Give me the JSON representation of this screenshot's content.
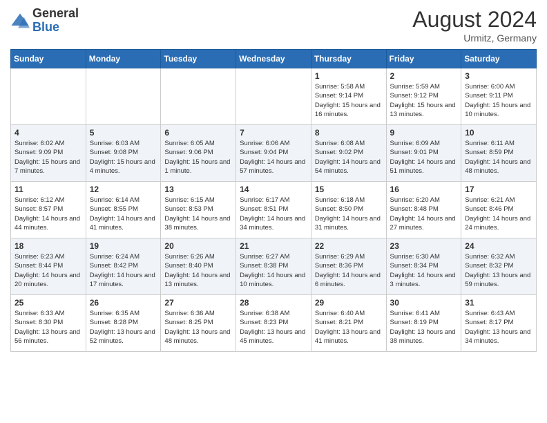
{
  "logo": {
    "general": "General",
    "blue": "Blue"
  },
  "title": "August 2024",
  "location": "Urmitz, Germany",
  "days_of_week": [
    "Sunday",
    "Monday",
    "Tuesday",
    "Wednesday",
    "Thursday",
    "Friday",
    "Saturday"
  ],
  "weeks": [
    [
      {
        "num": "",
        "sunrise": "",
        "sunset": "",
        "daylight": ""
      },
      {
        "num": "",
        "sunrise": "",
        "sunset": "",
        "daylight": ""
      },
      {
        "num": "",
        "sunrise": "",
        "sunset": "",
        "daylight": ""
      },
      {
        "num": "",
        "sunrise": "",
        "sunset": "",
        "daylight": ""
      },
      {
        "num": "1",
        "sunrise": "Sunrise: 5:58 AM",
        "sunset": "Sunset: 9:14 PM",
        "daylight": "Daylight: 15 hours and 16 minutes."
      },
      {
        "num": "2",
        "sunrise": "Sunrise: 5:59 AM",
        "sunset": "Sunset: 9:12 PM",
        "daylight": "Daylight: 15 hours and 13 minutes."
      },
      {
        "num": "3",
        "sunrise": "Sunrise: 6:00 AM",
        "sunset": "Sunset: 9:11 PM",
        "daylight": "Daylight: 15 hours and 10 minutes."
      }
    ],
    [
      {
        "num": "4",
        "sunrise": "Sunrise: 6:02 AM",
        "sunset": "Sunset: 9:09 PM",
        "daylight": "Daylight: 15 hours and 7 minutes."
      },
      {
        "num": "5",
        "sunrise": "Sunrise: 6:03 AM",
        "sunset": "Sunset: 9:08 PM",
        "daylight": "Daylight: 15 hours and 4 minutes."
      },
      {
        "num": "6",
        "sunrise": "Sunrise: 6:05 AM",
        "sunset": "Sunset: 9:06 PM",
        "daylight": "Daylight: 15 hours and 1 minute."
      },
      {
        "num": "7",
        "sunrise": "Sunrise: 6:06 AM",
        "sunset": "Sunset: 9:04 PM",
        "daylight": "Daylight: 14 hours and 57 minutes."
      },
      {
        "num": "8",
        "sunrise": "Sunrise: 6:08 AM",
        "sunset": "Sunset: 9:02 PM",
        "daylight": "Daylight: 14 hours and 54 minutes."
      },
      {
        "num": "9",
        "sunrise": "Sunrise: 6:09 AM",
        "sunset": "Sunset: 9:01 PM",
        "daylight": "Daylight: 14 hours and 51 minutes."
      },
      {
        "num": "10",
        "sunrise": "Sunrise: 6:11 AM",
        "sunset": "Sunset: 8:59 PM",
        "daylight": "Daylight: 14 hours and 48 minutes."
      }
    ],
    [
      {
        "num": "11",
        "sunrise": "Sunrise: 6:12 AM",
        "sunset": "Sunset: 8:57 PM",
        "daylight": "Daylight: 14 hours and 44 minutes."
      },
      {
        "num": "12",
        "sunrise": "Sunrise: 6:14 AM",
        "sunset": "Sunset: 8:55 PM",
        "daylight": "Daylight: 14 hours and 41 minutes."
      },
      {
        "num": "13",
        "sunrise": "Sunrise: 6:15 AM",
        "sunset": "Sunset: 8:53 PM",
        "daylight": "Daylight: 14 hours and 38 minutes."
      },
      {
        "num": "14",
        "sunrise": "Sunrise: 6:17 AM",
        "sunset": "Sunset: 8:51 PM",
        "daylight": "Daylight: 14 hours and 34 minutes."
      },
      {
        "num": "15",
        "sunrise": "Sunrise: 6:18 AM",
        "sunset": "Sunset: 8:50 PM",
        "daylight": "Daylight: 14 hours and 31 minutes."
      },
      {
        "num": "16",
        "sunrise": "Sunrise: 6:20 AM",
        "sunset": "Sunset: 8:48 PM",
        "daylight": "Daylight: 14 hours and 27 minutes."
      },
      {
        "num": "17",
        "sunrise": "Sunrise: 6:21 AM",
        "sunset": "Sunset: 8:46 PM",
        "daylight": "Daylight: 14 hours and 24 minutes."
      }
    ],
    [
      {
        "num": "18",
        "sunrise": "Sunrise: 6:23 AM",
        "sunset": "Sunset: 8:44 PM",
        "daylight": "Daylight: 14 hours and 20 minutes."
      },
      {
        "num": "19",
        "sunrise": "Sunrise: 6:24 AM",
        "sunset": "Sunset: 8:42 PM",
        "daylight": "Daylight: 14 hours and 17 minutes."
      },
      {
        "num": "20",
        "sunrise": "Sunrise: 6:26 AM",
        "sunset": "Sunset: 8:40 PM",
        "daylight": "Daylight: 14 hours and 13 minutes."
      },
      {
        "num": "21",
        "sunrise": "Sunrise: 6:27 AM",
        "sunset": "Sunset: 8:38 PM",
        "daylight": "Daylight: 14 hours and 10 minutes."
      },
      {
        "num": "22",
        "sunrise": "Sunrise: 6:29 AM",
        "sunset": "Sunset: 8:36 PM",
        "daylight": "Daylight: 14 hours and 6 minutes."
      },
      {
        "num": "23",
        "sunrise": "Sunrise: 6:30 AM",
        "sunset": "Sunset: 8:34 PM",
        "daylight": "Daylight: 14 hours and 3 minutes."
      },
      {
        "num": "24",
        "sunrise": "Sunrise: 6:32 AM",
        "sunset": "Sunset: 8:32 PM",
        "daylight": "Daylight: 13 hours and 59 minutes."
      }
    ],
    [
      {
        "num": "25",
        "sunrise": "Sunrise: 6:33 AM",
        "sunset": "Sunset: 8:30 PM",
        "daylight": "Daylight: 13 hours and 56 minutes."
      },
      {
        "num": "26",
        "sunrise": "Sunrise: 6:35 AM",
        "sunset": "Sunset: 8:28 PM",
        "daylight": "Daylight: 13 hours and 52 minutes."
      },
      {
        "num": "27",
        "sunrise": "Sunrise: 6:36 AM",
        "sunset": "Sunset: 8:25 PM",
        "daylight": "Daylight: 13 hours and 48 minutes."
      },
      {
        "num": "28",
        "sunrise": "Sunrise: 6:38 AM",
        "sunset": "Sunset: 8:23 PM",
        "daylight": "Daylight: 13 hours and 45 minutes."
      },
      {
        "num": "29",
        "sunrise": "Sunrise: 6:40 AM",
        "sunset": "Sunset: 8:21 PM",
        "daylight": "Daylight: 13 hours and 41 minutes."
      },
      {
        "num": "30",
        "sunrise": "Sunrise: 6:41 AM",
        "sunset": "Sunset: 8:19 PM",
        "daylight": "Daylight: 13 hours and 38 minutes."
      },
      {
        "num": "31",
        "sunrise": "Sunrise: 6:43 AM",
        "sunset": "Sunset: 8:17 PM",
        "daylight": "Daylight: 13 hours and 34 minutes."
      }
    ]
  ]
}
